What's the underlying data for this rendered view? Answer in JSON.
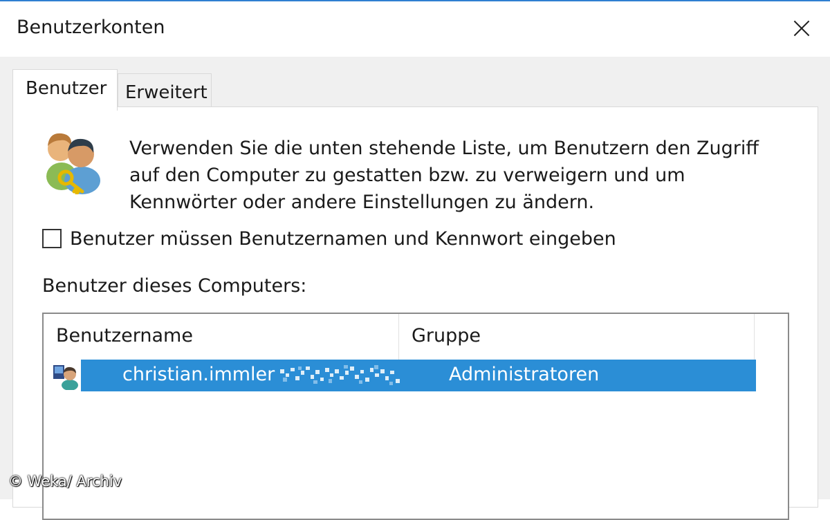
{
  "window": {
    "title": "Benutzerkonten",
    "close_icon": "close-icon",
    "accent_color": "#2f7fd1"
  },
  "tabs": [
    {
      "label": "Benutzer",
      "active": true
    },
    {
      "label": "Erweitert",
      "active": false
    }
  ],
  "users_tab": {
    "icon": "users-key-icon",
    "description_lines": [
      "Verwenden Sie die unten stehende Liste, um Benutzern den Zugriff",
      "auf den Computer zu gestatten bzw. zu verweigern und um",
      "Kennwörter oder andere Einstellungen zu ändern."
    ],
    "require_login": {
      "label": "Benutzer müssen Benutzernamen und Kennwort eingeben",
      "checked": false
    },
    "list_label": "Benutzer dieses Computers:",
    "columns": [
      "Benutzername",
      "Gruppe"
    ],
    "rows": [
      {
        "icon": "user-icon",
        "name": "christian.immler",
        "group": "Administratoren",
        "selected": true
      }
    ],
    "selection_color": "#2b8ed6"
  },
  "watermark": "© Weka/ Archiv"
}
